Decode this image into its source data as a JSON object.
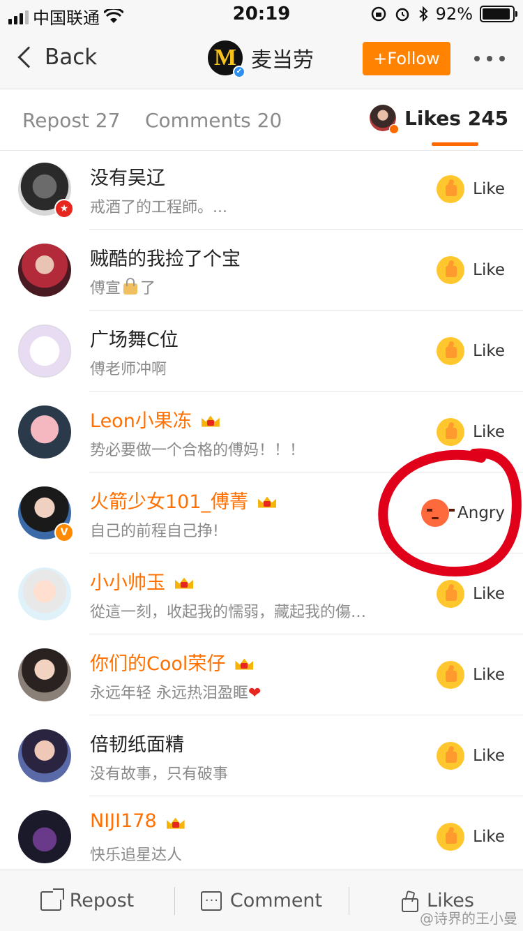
{
  "status_bar": {
    "carrier": "中国联通",
    "time": "20:19",
    "battery_text": "92%",
    "battery_level": 0.92
  },
  "nav": {
    "back_label": "Back",
    "logo_glyph": "M",
    "title": "麦当劳",
    "follow_label": "+Follow"
  },
  "tabs": {
    "repost": "Repost 27",
    "comments": "Comments 20",
    "likes": "Likes 245"
  },
  "list": [
    {
      "name": "没有吴辽",
      "sub": "戒酒了的工程師。...",
      "reaction": "Like",
      "vip": false,
      "badge": "red"
    },
    {
      "name": "贼酷的我捡了个宝",
      "sub_before": "傅宣",
      "sub_after": "了",
      "reaction": "Like",
      "vip": false
    },
    {
      "name": "广场舞C位",
      "sub": "傅老师冲啊",
      "reaction": "Like",
      "vip": false
    },
    {
      "name": "Leon小果冻",
      "sub": "势必要做一个合格的傅妈！！！",
      "reaction": "Like",
      "vip": true
    },
    {
      "name": "火箭少女101_傅菁",
      "sub": "自己的前程自己挣!",
      "reaction": "Angry",
      "vip": true,
      "badge": "orange",
      "badge_glyph": "V"
    },
    {
      "name": "小小帅玉",
      "sub": "從這一刻，收起我的懦弱，藏起我的傷…",
      "reaction": "Like",
      "vip": true
    },
    {
      "name": "你们的Cool荣仔",
      "sub": "永远年轻 永远热泪盈眶",
      "reaction": "Like",
      "vip": true,
      "heart": "❤"
    },
    {
      "name": "倍韧纸面精",
      "sub": "没有故事，只有破事",
      "reaction": "Like",
      "vip": false
    },
    {
      "name": "NIJI178",
      "sub": "快乐追星达人",
      "reaction": "Like",
      "vip": true
    }
  ],
  "bottom_bar": {
    "repost": "Repost",
    "comment": "Comment",
    "likes": "Likes"
  },
  "watermark": "@诗界的王小曼",
  "colors": {
    "accent": "#ff8200",
    "vip_name": "#ff7000",
    "annotation": "#e0001a"
  }
}
